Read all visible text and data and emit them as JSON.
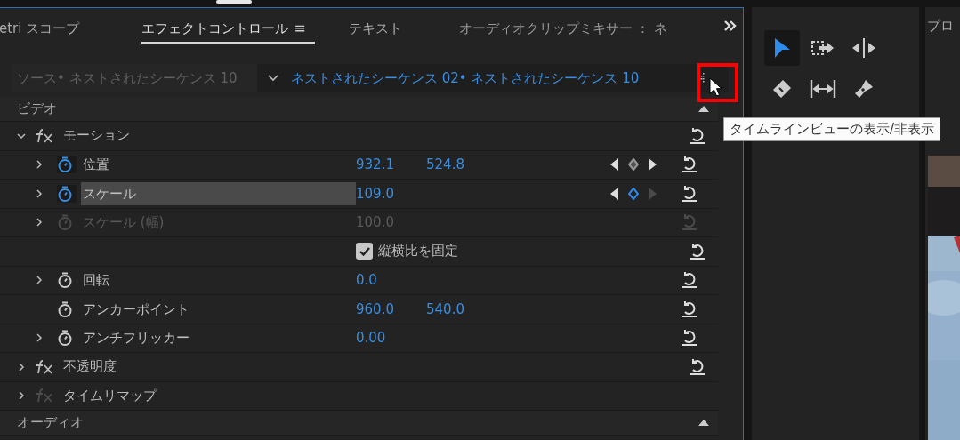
{
  "tabs": [
    {
      "label": "etri スコープ",
      "selected": false
    },
    {
      "label": "エフェクトコントロール",
      "selected": true,
      "menu_icon": "≡"
    },
    {
      "label": "テキスト",
      "selected": false
    },
    {
      "label": "オーディオクリップミキサー ： ネ",
      "selected": false
    }
  ],
  "source_bar": {
    "source": "ソース• ネストされたシーケンス 10",
    "sequence": "ネストされたシーケンス 02• ネストされたシーケンス 10"
  },
  "video_header": "ビデオ",
  "effects": [
    {
      "kind": "effect",
      "name": "モーション",
      "expanded": true,
      "enabled": true,
      "properties": [
        {
          "kind": "property",
          "name": "位置",
          "expandable": true,
          "animated": true,
          "selected": false,
          "disabled": false,
          "values": [
            "932.1",
            "524.8"
          ],
          "keyframe": {
            "on_keyframe": false,
            "has_next": true
          }
        },
        {
          "kind": "property",
          "name": "スケール",
          "expandable": true,
          "animated": true,
          "selected": true,
          "disabled": false,
          "values": [
            "109.0"
          ],
          "keyframe": {
            "on_keyframe": true,
            "has_next": false
          }
        },
        {
          "kind": "property",
          "name": "スケール (幅)",
          "expandable": true,
          "animated": false,
          "selected": false,
          "disabled": true,
          "values": [
            "100.0"
          ]
        },
        {
          "kind": "checkbox",
          "label": "縦横比を固定",
          "checked": true
        },
        {
          "kind": "property",
          "name": "回転",
          "expandable": true,
          "animated": false,
          "selected": false,
          "disabled": false,
          "values": [
            "0.0"
          ]
        },
        {
          "kind": "property",
          "name": "アンカーポイント",
          "expandable": false,
          "animated": false,
          "selected": false,
          "disabled": false,
          "values": [
            "960.0",
            "540.0"
          ]
        },
        {
          "kind": "property",
          "name": "アンチフリッカー",
          "expandable": true,
          "animated": false,
          "selected": false,
          "disabled": false,
          "values": [
            "0.00"
          ]
        }
      ]
    },
    {
      "kind": "effect",
      "name": "不透明度",
      "expanded": false,
      "enabled": true
    },
    {
      "kind": "effect",
      "name": "タイムリマップ",
      "expanded": false,
      "enabled": false
    }
  ],
  "audio_header": "オーディオ",
  "tooltip": "タイムラインビューの表示/非表示",
  "tools": [
    {
      "kind": "selection",
      "selected": true
    },
    {
      "kind": "track-select",
      "selected": false
    },
    {
      "kind": "ripple",
      "selected": false
    },
    {
      "kind": "razor",
      "selected": false
    },
    {
      "kind": "slip",
      "selected": false
    },
    {
      "kind": "pen",
      "selected": false
    }
  ],
  "program_panel": {
    "title": "プロ"
  }
}
